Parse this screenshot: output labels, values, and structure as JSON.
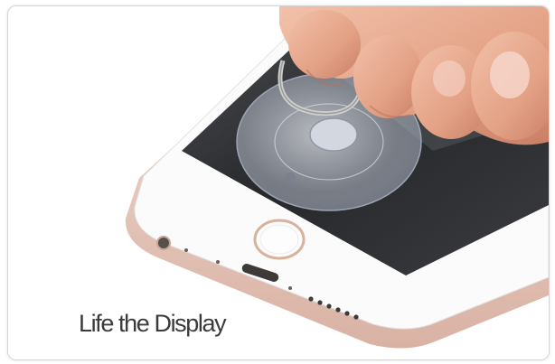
{
  "caption": "Life the Display",
  "colors": {
    "background": "#ffffff",
    "phone_frame": "#ffffff",
    "phone_body": "#e7c9bd",
    "screen": "#2b2d30",
    "skin": "#e7a990",
    "suction_cup": "#c7ccd6",
    "caption_text": "#3b3b3b"
  }
}
